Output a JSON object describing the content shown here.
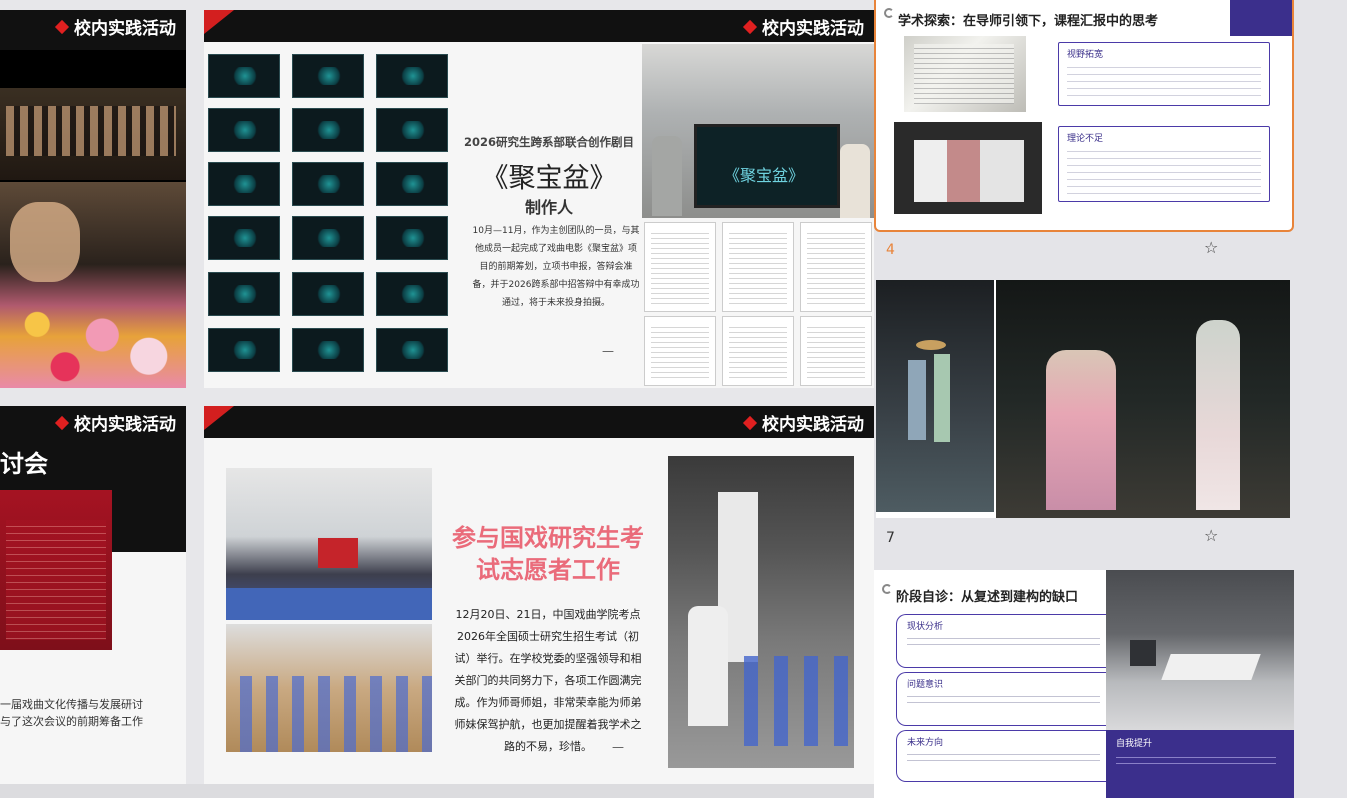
{
  "slides": {
    "tag_label": "校内实践活动",
    "slide_a": {},
    "slide_b": {
      "title_line1": "2026研究生跨系部联合创作剧目",
      "title_main": "《聚宝盆》",
      "title_sub": "制作人",
      "body": "10月—11月，作为主创团队的一员，与其他成员一起完成了戏曲电影《聚宝盆》项目的前期筹划，立项书申报，答辩会准备，并于2026跨系部中招答辩中有幸成功通过，将于未来投身拍摄。",
      "dash": "—"
    },
    "slide_c": {
      "title_partial": "讨会",
      "footer_line1": "一届戏曲文化传播与发展研讨",
      "footer_line2": "与了这次会议的前期筹备工作"
    },
    "slide_d": {
      "heading": "参与国戏研究生考试志愿者工作",
      "body": "12月20日、21日，中国戏曲学院考点2026年全国硕士研究生招生考试（初试）举行。在学校党委的坚强领导和相关部门的共同努力下，各项工作圆满完成。作为师哥师姐，非常荣幸能为师弟师妹保驾护航，也更加提醒着我学术之路的不易，珍惜。",
      "dash": "—"
    }
  },
  "panel": {
    "slide4": {
      "number": "4",
      "title": "学术探索：在导师引领下，课程汇报中的思考",
      "card1_title": "视野拓宽",
      "card2_title": "理论不足"
    },
    "slide7": {
      "number": "7"
    },
    "slide8": {
      "title": "阶段自诊：从复述到建构的缺口",
      "step1": "现状分析",
      "step2": "问题意识",
      "step3": "未来方向",
      "box_title": "自我提升"
    }
  },
  "icons": {
    "star": "star-icon"
  },
  "colors": {
    "accent_red": "#d31f1f",
    "accent_purple": "#4b3aa8",
    "selected_border": "#e8843a"
  }
}
